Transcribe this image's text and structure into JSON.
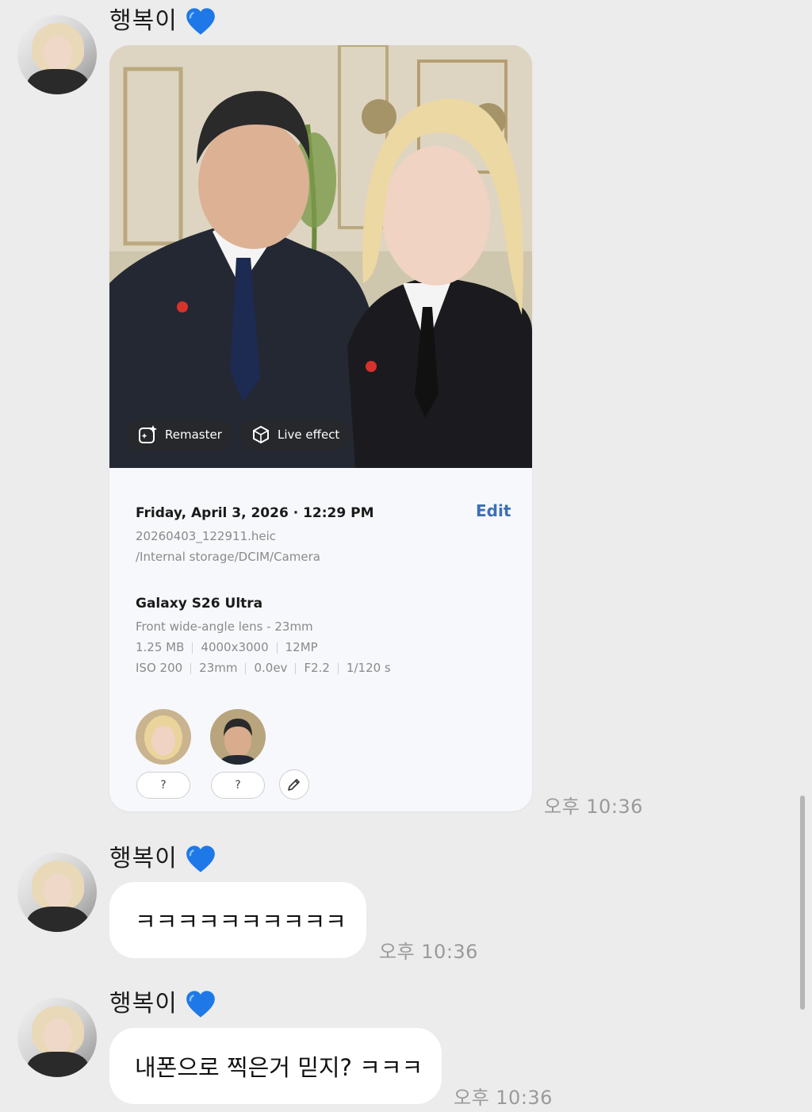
{
  "colors": {
    "background": "#ececec",
    "bubble": "#ffffff",
    "heart": "#1e78e8",
    "edit_link": "#3d6fb5"
  },
  "messages": [
    {
      "sender": "행복이",
      "sender_icon": "blue-heart-icon",
      "type": "photo-card",
      "time": "오후 10:36",
      "card": {
        "actions": [
          "Remaster",
          "Live effect"
        ],
        "datetime": "Friday, April 3, 2026 · 12:29 PM",
        "edit_label": "Edit",
        "filename": "20260403_122911.heic",
        "path": "/Internal storage/DCIM/Camera",
        "device": "Galaxy S26 Ultra",
        "lens": "Front wide-angle lens - 23mm",
        "file_specs": [
          "1.25 MB",
          "4000x3000",
          "12MP"
        ],
        "exposure": [
          "ISO 200",
          "23mm",
          "0.0ev",
          "F2.2",
          "1/120 s"
        ],
        "people_tags": [
          "?",
          "?"
        ]
      }
    },
    {
      "sender": "행복이",
      "sender_icon": "blue-heart-icon",
      "type": "text",
      "text": "ㅋㅋㅋㅋㅋㅋㅋㅋㅋㅋ",
      "time": "오후 10:36"
    },
    {
      "sender": "행복이",
      "sender_icon": "blue-heart-icon",
      "type": "text",
      "text": "내폰으로 찍은거 믿지? ㅋㅋㅋ",
      "time": "오후 10:36"
    }
  ]
}
